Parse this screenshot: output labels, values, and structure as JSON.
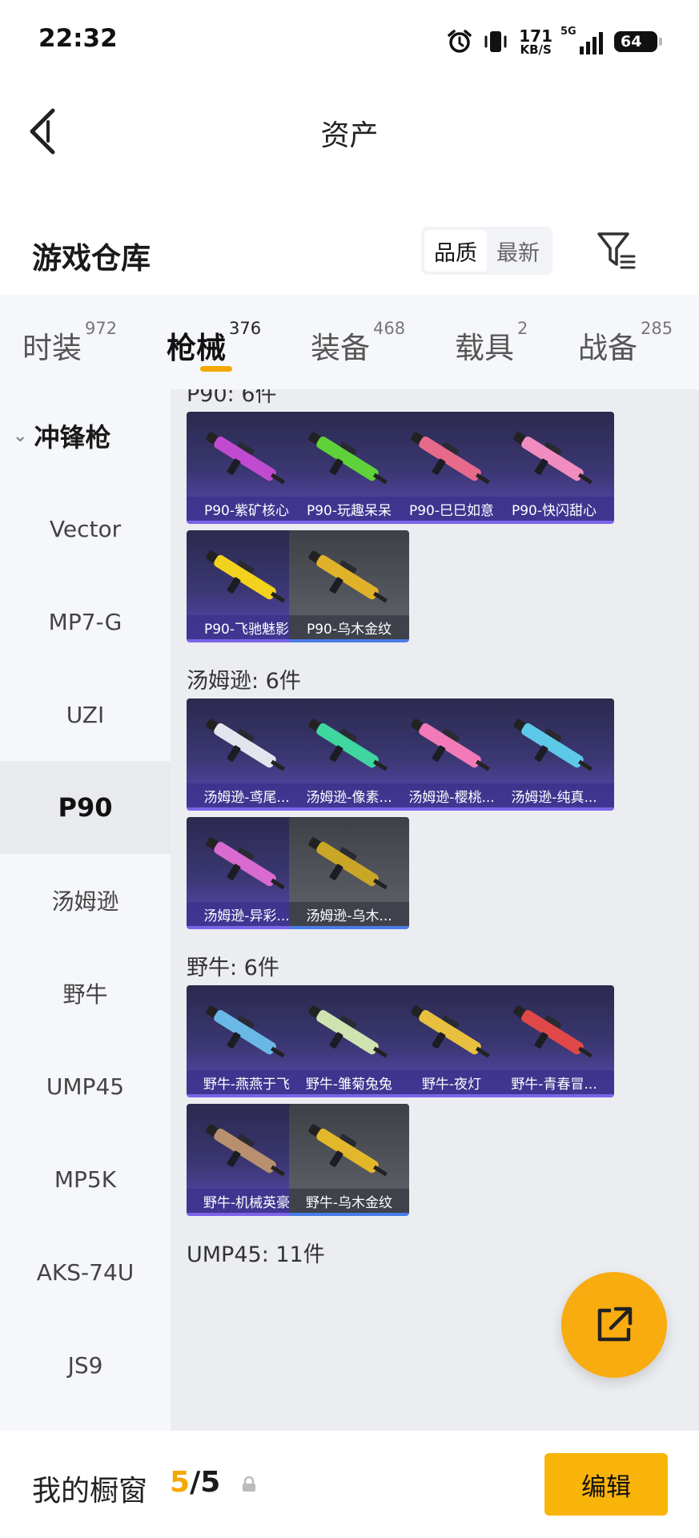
{
  "status_bar": {
    "time": "22:32",
    "net_speed_value": "171",
    "net_speed_unit": "KB/S",
    "network_type": "5G",
    "battery": "64"
  },
  "header": {
    "title": "资产"
  },
  "repository": {
    "title": "游戏仓库",
    "sort_options": [
      "品质",
      "最新"
    ],
    "active_sort": "品质"
  },
  "tabs": [
    {
      "label": "时装",
      "count": "972"
    },
    {
      "label": "枪械",
      "count": "376",
      "active": true
    },
    {
      "label": "装备",
      "count": "468"
    },
    {
      "label": "载具",
      "count": "2"
    },
    {
      "label": "战备",
      "count": "285"
    }
  ],
  "sidebar": {
    "category": "冲锋枪",
    "items": [
      "Vector",
      "MP7-G",
      "UZI",
      "P90",
      "汤姆逊",
      "野牛",
      "UMP45",
      "MP5K",
      "AKS-74U",
      "JS9"
    ],
    "active": "P90"
  },
  "sections": [
    {
      "title": "P90: 6件",
      "items": [
        {
          "name": "P90-紫矿核心",
          "tint": "#c04bd0"
        },
        {
          "name": "P90-玩趣呆呆",
          "tint": "#5fd13a"
        },
        {
          "name": "P90-巳巳如意",
          "tint": "#e86a8a"
        },
        {
          "name": "P90-快闪甜心",
          "tint": "#f08cc0"
        },
        {
          "name": "P90-飞驰魅影",
          "tint": "#f2d21c"
        },
        {
          "name": "P90-乌木金纹",
          "tint": "#e0b22a",
          "gray": true
        }
      ]
    },
    {
      "title": "汤姆逊: 6件",
      "items": [
        {
          "name": "汤姆逊-鸢尾...",
          "tint": "#e4e4ee"
        },
        {
          "name": "汤姆逊-像素...",
          "tint": "#3fd6a0"
        },
        {
          "name": "汤姆逊-樱桃...",
          "tint": "#f27ab8"
        },
        {
          "name": "汤姆逊-纯真...",
          "tint": "#5ec8e8"
        },
        {
          "name": "汤姆逊-异彩...",
          "tint": "#d86ad0"
        },
        {
          "name": "汤姆逊-乌木...",
          "tint": "#c9a626",
          "gray": true
        }
      ]
    },
    {
      "title": "野牛: 6件",
      "items": [
        {
          "name": "野牛-燕燕于飞",
          "tint": "#6ab8e6"
        },
        {
          "name": "野牛-雏菊兔兔",
          "tint": "#cfe3b0"
        },
        {
          "name": "野牛-夜灯",
          "tint": "#e8c040"
        },
        {
          "name": "野牛-青春冒...",
          "tint": "#e04848"
        },
        {
          "name": "野牛-机械英豪",
          "tint": "#b89070"
        },
        {
          "name": "野牛-乌木金纹",
          "tint": "#e2b82a",
          "gray": true
        }
      ]
    },
    {
      "title": "UMP45: 11件",
      "items": []
    }
  ],
  "bottom_bar": {
    "label": "我的橱窗",
    "current": "5",
    "separator": "/",
    "total": "5",
    "edit_label": "编辑"
  },
  "colors": {
    "accent": "#f5a800",
    "card_purple": "#3b3773",
    "card_gray": "#54565e"
  }
}
